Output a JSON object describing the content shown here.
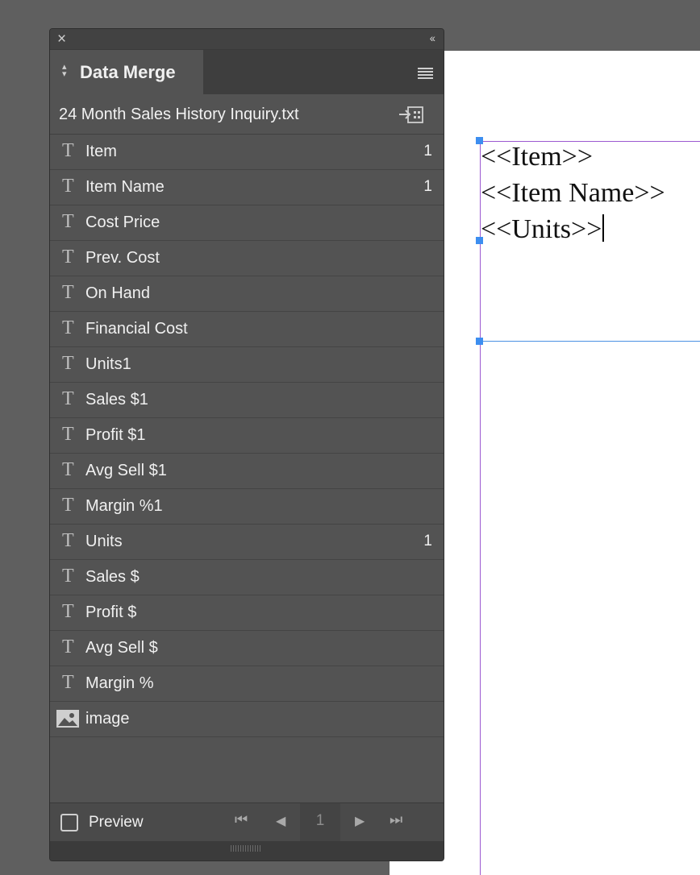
{
  "panel": {
    "close_glyph": "×",
    "collapse_glyph": "‹‹",
    "tab_title": "Data Merge",
    "source_file": "24 Month Sales History Inquiry.txt",
    "fields": [
      {
        "type": "T",
        "name": "Item",
        "count": "1"
      },
      {
        "type": "T",
        "name": "Item Name",
        "count": "1"
      },
      {
        "type": "T",
        "name": "Cost Price",
        "count": ""
      },
      {
        "type": "T",
        "name": "Prev. Cost",
        "count": ""
      },
      {
        "type": "T",
        "name": "On Hand",
        "count": ""
      },
      {
        "type": "T",
        "name": "Financial Cost",
        "count": ""
      },
      {
        "type": "T",
        "name": "Units1",
        "count": ""
      },
      {
        "type": "T",
        "name": "Sales $1",
        "count": ""
      },
      {
        "type": "T",
        "name": "Profit $1",
        "count": ""
      },
      {
        "type": "T",
        "name": "Avg Sell $1",
        "count": ""
      },
      {
        "type": "T",
        "name": "Margin %1",
        "count": ""
      },
      {
        "type": "T",
        "name": "Units",
        "count": "1"
      },
      {
        "type": "T",
        "name": "Sales $",
        "count": ""
      },
      {
        "type": "T",
        "name": "Profit $",
        "count": ""
      },
      {
        "type": "T",
        "name": "Avg Sell $",
        "count": ""
      },
      {
        "type": "T",
        "name": "Margin %",
        "count": ""
      },
      {
        "type": "image",
        "name": "image",
        "count": ""
      }
    ],
    "footer": {
      "preview_label": "Preview",
      "page_number": "1",
      "first_glyph": "⏮",
      "prev_glyph": "◀",
      "next_glyph": "▶",
      "last_glyph": "⏭"
    }
  },
  "document": {
    "frame_lines": [
      "<<Item>>",
      "<<Item Name>>",
      "<<Units>>"
    ]
  },
  "colors": {
    "panel_bg": "#535353",
    "frame_purple": "#9b59d0",
    "handle_blue": "#3d8ef0"
  }
}
